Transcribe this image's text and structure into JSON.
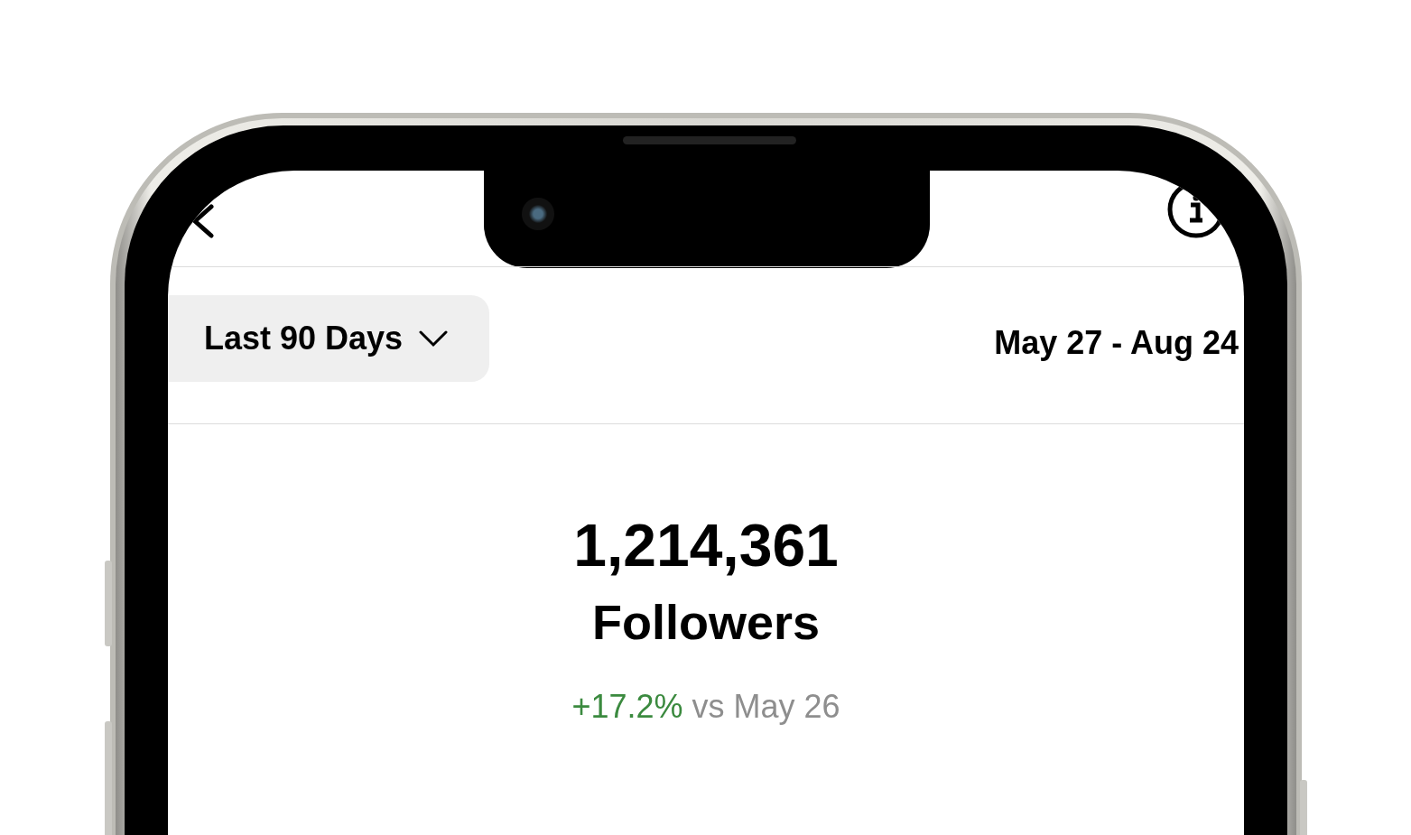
{
  "range_button": {
    "label": "Last 90 Days"
  },
  "date_range": "May 27 - Aug 24",
  "metric": {
    "value": "1,214,361",
    "label": "Followers",
    "change": "+17.2%",
    "comparison": "vs May 26"
  }
}
